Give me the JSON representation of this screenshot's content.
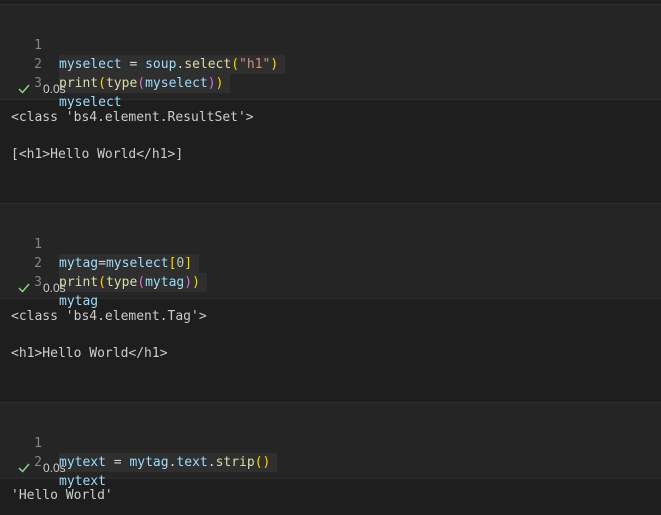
{
  "cells": [
    {
      "lines": [
        {
          "n": "1",
          "t": [
            "myselect",
            " = ",
            "soup",
            ".",
            "select",
            "(",
            "\"h1\"",
            ")"
          ]
        },
        {
          "n": "2",
          "t": [
            "print",
            "(",
            "type",
            "(",
            "myselect",
            ")",
            ")"
          ]
        },
        {
          "n": "3",
          "t": [
            "myselect"
          ]
        }
      ],
      "time": "0.0s",
      "output": [
        "<class 'bs4.element.ResultSet'>",
        "[<h1>Hello World</h1>]"
      ]
    },
    {
      "lines": [
        {
          "n": "1",
          "t": [
            "mytag",
            "=",
            "myselect",
            "[",
            "0",
            "]"
          ]
        },
        {
          "n": "2",
          "t": [
            "print",
            "(",
            "type",
            "(",
            "mytag",
            ")",
            ")"
          ]
        },
        {
          "n": "3",
          "t": [
            "mytag"
          ]
        }
      ],
      "time": "0.0s",
      "output": [
        "<class 'bs4.element.Tag'>",
        "<h1>Hello World</h1>"
      ]
    },
    {
      "lines": [
        {
          "n": "1",
          "t": [
            "mytext",
            " = ",
            "mytag",
            ".",
            "text",
            ".",
            "strip",
            "()"
          ]
        },
        {
          "n": "2",
          "t": [
            "mytext"
          ]
        }
      ],
      "time": "0.0s",
      "output": [
        "'Hello World'"
      ]
    }
  ],
  "colors": {
    "variable": "#9cdcfe",
    "function": "#dcdcaa",
    "string": "#ce9178",
    "number": "#b5cea8",
    "bracket_level1": "#ffd700",
    "bracket_level2": "#da70d6",
    "success_check": "#89d185"
  },
  "icons": {
    "status": "check-icon"
  }
}
